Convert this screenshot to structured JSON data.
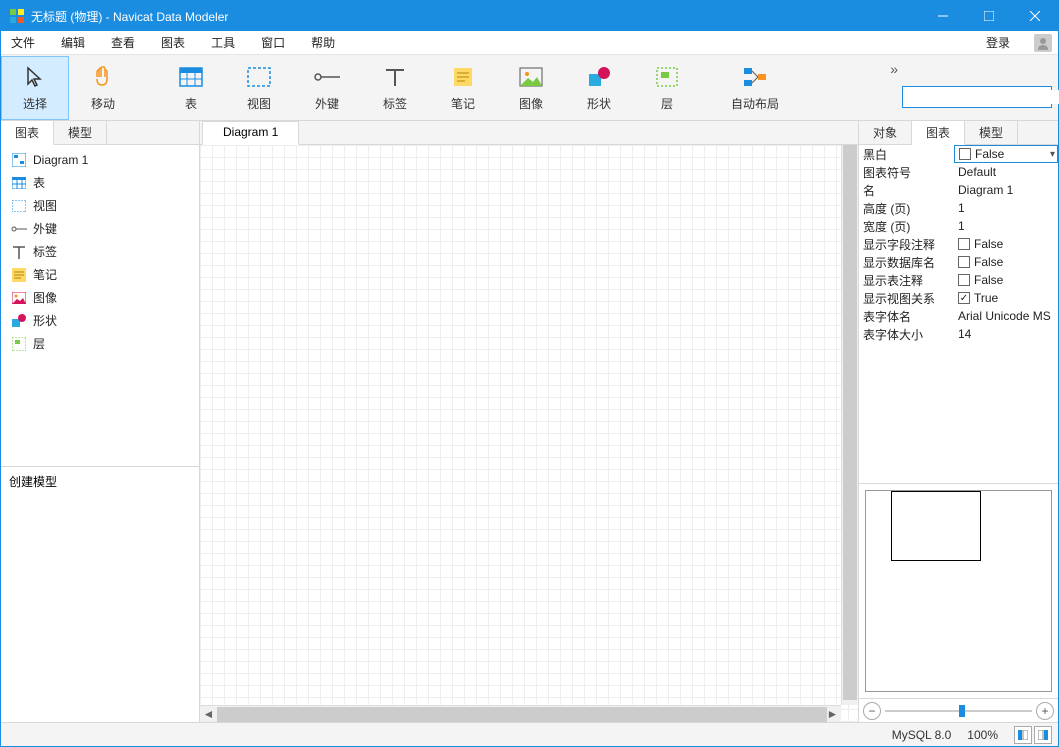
{
  "window": {
    "title": "无标题 (物理) - Navicat Data Modeler"
  },
  "menu": {
    "file": "文件",
    "edit": "编辑",
    "view": "查看",
    "diagram": "图表",
    "tools": "工具",
    "window": "窗口",
    "help": "帮助",
    "login": "登录"
  },
  "toolbar": {
    "select": "选择",
    "move": "移动",
    "table": "表",
    "view": "视图",
    "fk": "外键",
    "label": "标签",
    "note": "笔记",
    "image": "图像",
    "shape": "形状",
    "layer": "层",
    "autolayout": "自动布局",
    "search_placeholder": ""
  },
  "leftTabs": {
    "diagram": "图表",
    "model": "模型"
  },
  "tree": {
    "diagram1": "Diagram 1",
    "table": "表",
    "view": "视图",
    "fk": "外键",
    "label": "标签",
    "note": "笔记",
    "image": "图像",
    "shape": "形状",
    "layer": "层"
  },
  "leftBottom": {
    "title": "创建模型"
  },
  "centerTab": "Diagram 1",
  "rightTabs": {
    "object": "对象",
    "diagram": "图表",
    "model": "模型"
  },
  "props": {
    "bw": {
      "label": "黑白",
      "value": "False",
      "checked": false
    },
    "symbol": {
      "label": "图表符号",
      "value": "Default"
    },
    "name": {
      "label": "名",
      "value": "Diagram 1"
    },
    "heightPages": {
      "label": "高度 (页)",
      "value": "1"
    },
    "widthPages": {
      "label": "宽度 (页)",
      "value": "1"
    },
    "showFieldComment": {
      "label": "显示字段注释",
      "value": "False",
      "checked": false
    },
    "showDbName": {
      "label": "显示数据库名",
      "value": "False",
      "checked": false
    },
    "showTableComment": {
      "label": "显示表注释",
      "value": "False",
      "checked": false
    },
    "showViewRel": {
      "label": "显示视图关系",
      "value": "True",
      "checked": true
    },
    "tableFontName": {
      "label": "表字体名",
      "value": "Arial Unicode MS"
    },
    "tableFontSize": {
      "label": "表字体大小",
      "value": "14"
    }
  },
  "status": {
    "db": "MySQL 8.0",
    "zoom": "100%"
  }
}
